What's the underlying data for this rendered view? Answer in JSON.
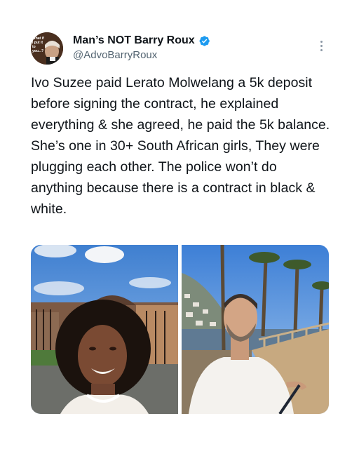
{
  "tweet": {
    "author": {
      "display_name": "Man’s NOT Barry Roux",
      "handle": "@AdvoBarryRoux",
      "verified": true,
      "verified_color": "#1d9bf0",
      "avatar_text": "What if I put it to you...?"
    },
    "text": "Ivo Suzee paid Lerato Molwelang a 5k deposit before signing the contract, he explained everything & she agreed, he paid the 5k balance. She’s one in 30+ South African girls, They were plugging each other. The police won’t do anything because there is a contract in black & white.",
    "menu_icon": "more-vertical-icon",
    "media": [
      {
        "subject": "smiling young woman with curly hair outdoors"
      },
      {
        "subject": "bearded man in white shirt by the seaside with palm trees"
      }
    ]
  },
  "colors": {
    "text_primary": "#0f1419",
    "text_secondary": "#536471",
    "background": "#ffffff"
  }
}
